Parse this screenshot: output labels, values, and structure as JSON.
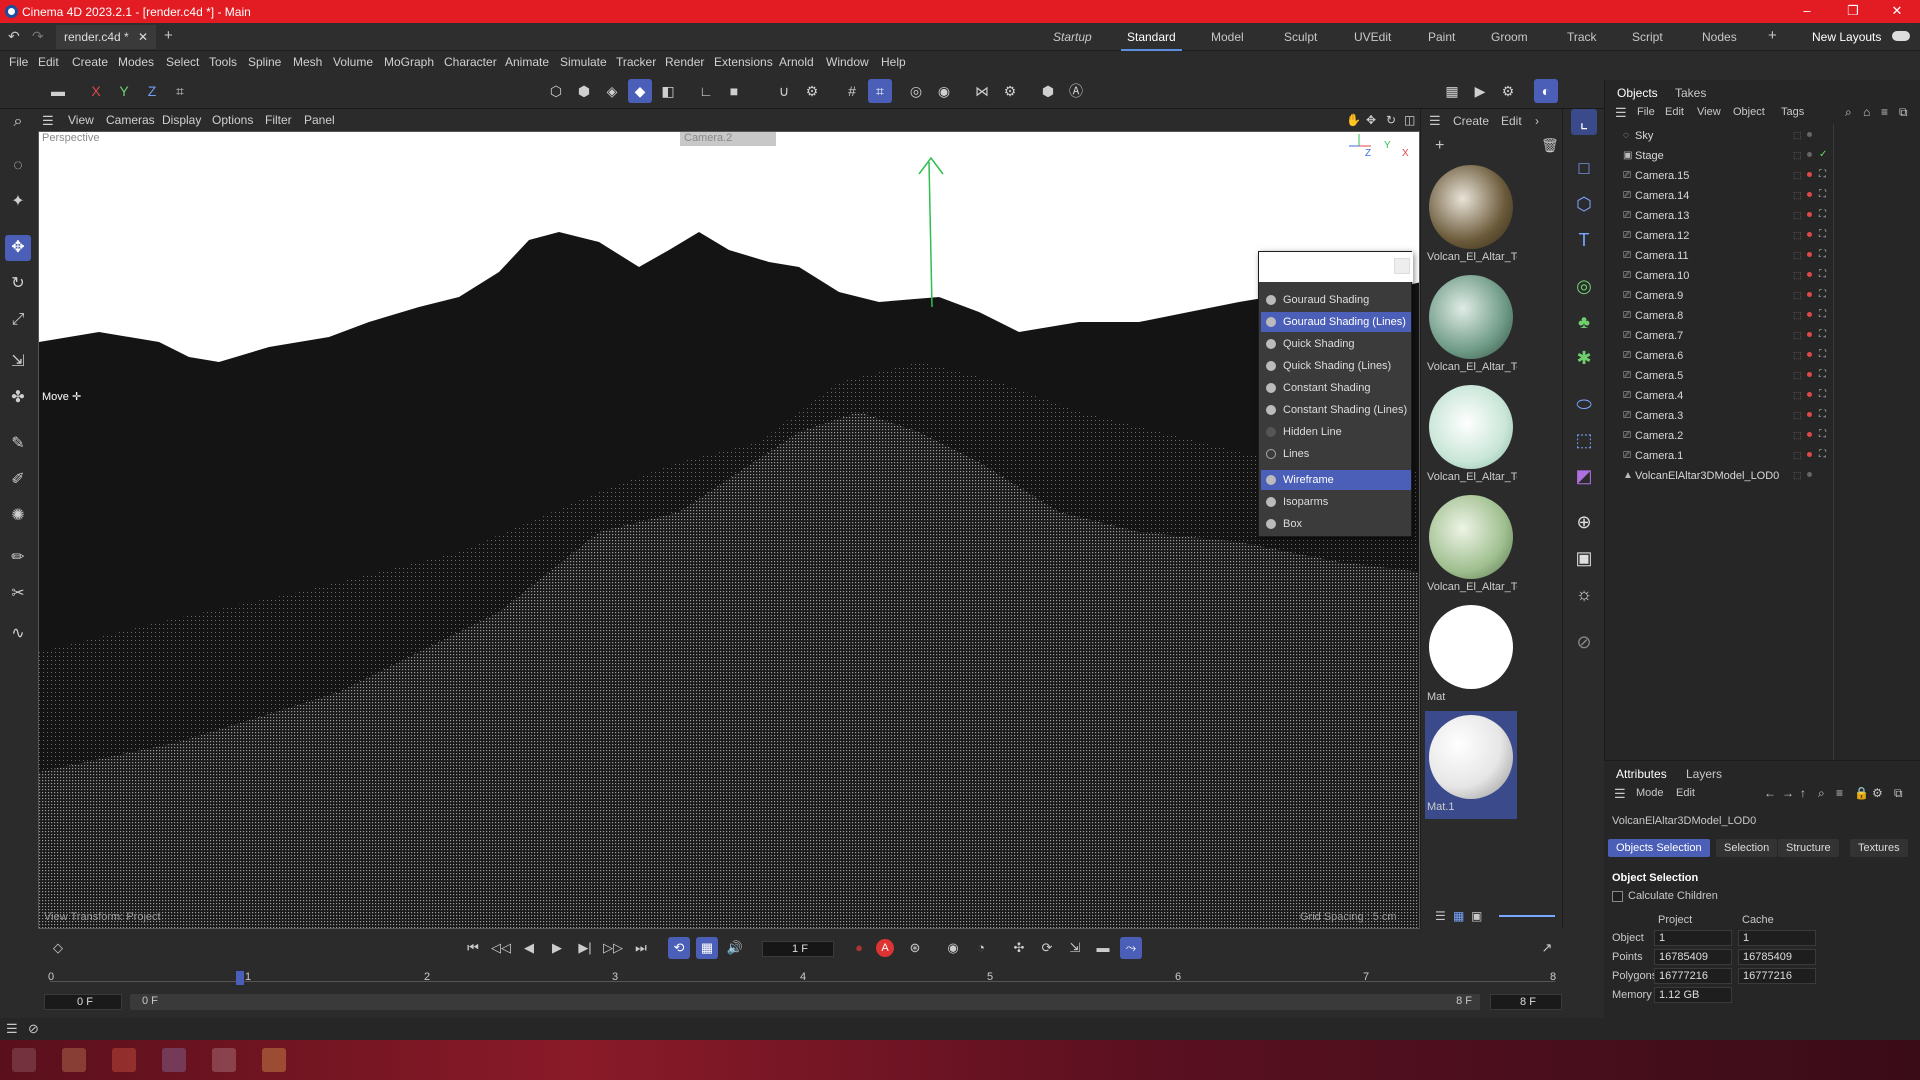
{
  "app": {
    "title": "Cinema 4D 2023.2.1 - [render.c4d *] - Main",
    "doc_tab": "render.c4d *",
    "window_controls": [
      "–",
      "❐",
      "✕"
    ]
  },
  "layouts": {
    "items": [
      "Startup",
      "Standard",
      "Model",
      "Sculpt",
      "UVEdit",
      "Paint",
      "Groom",
      "Track",
      "Script",
      "Nodes"
    ],
    "active": "Standard",
    "new_layouts": "New Layouts"
  },
  "menubar": [
    "File",
    "Edit",
    "Create",
    "Modes",
    "Select",
    "Tools",
    "Spline",
    "Mesh",
    "Volume",
    "MoGraph",
    "Character",
    "Animate",
    "Simulate",
    "Tracker",
    "Render",
    "Extensions",
    "Arnold",
    "Window",
    "Help"
  ],
  "toolbar": {
    "axes": [
      "X",
      "Y",
      "Z"
    ]
  },
  "viewport": {
    "menu": [
      "View",
      "Cameras",
      "Display",
      "Options",
      "Filter",
      "Panel"
    ],
    "label": "Perspective",
    "camera": "Camera.2",
    "move_label": "Move",
    "bottom_left": "View Transform: Project",
    "bottom_right": "Grid Spacing : 5 cm",
    "axis_labels": [
      "Z",
      "Y",
      "X"
    ]
  },
  "shading_menu": {
    "items": [
      {
        "label": "Gouraud Shading",
        "active": false
      },
      {
        "label": "Gouraud Shading (Lines)",
        "active": true
      },
      {
        "label": "Quick Shading",
        "active": false
      },
      {
        "label": "Quick Shading (Lines)",
        "active": false
      },
      {
        "label": "Constant Shading",
        "active": false
      },
      {
        "label": "Constant Shading (Lines)",
        "active": false
      },
      {
        "label": "Hidden Line",
        "active": false
      },
      {
        "label": "Lines",
        "active": false
      },
      {
        "label": "Wireframe",
        "active": true
      },
      {
        "label": "Isoparms",
        "active": false
      },
      {
        "label": "Box",
        "active": false
      }
    ]
  },
  "materials": {
    "menu": [
      "Create",
      "Edit"
    ],
    "items": [
      {
        "name": "Volcan_El_Altar_Te",
        "color": "#6b5a3a"
      },
      {
        "name": "Volcan_El_Altar_Te",
        "color": "#6e9a86"
      },
      {
        "name": "Volcan_El_Altar_Te",
        "color": "#c9e6d8"
      },
      {
        "name": "Volcan_El_Altar_Te",
        "color": "#9fbf8f"
      },
      {
        "name": "Mat",
        "color": "#ffffff"
      },
      {
        "name": "Mat.1",
        "color": "#e6e6e6"
      }
    ]
  },
  "objects": {
    "tabs": [
      "Objects",
      "Takes"
    ],
    "menu": [
      "File",
      "Edit",
      "View",
      "Object",
      "Tags"
    ],
    "items": [
      "Sky",
      "Stage",
      "Camera.15",
      "Camera.14",
      "Camera.13",
      "Camera.12",
      "Camera.11",
      "Camera.10",
      "Camera.9",
      "Camera.8",
      "Camera.7",
      "Camera.6",
      "Camera.5",
      "Camera.4",
      "Camera.3",
      "Camera.2",
      "Camera.1",
      "VolcanElAltar3DModel_LOD0"
    ]
  },
  "attributes": {
    "tabs": [
      "Attributes",
      "Layers"
    ],
    "menu": [
      "Mode",
      "Edit"
    ],
    "object_name": "VolcanElAltar3DModel_LOD0",
    "buttons": [
      "Objects Selection",
      "Selection",
      "Structure",
      "Textures"
    ],
    "section": "Object Selection",
    "calculate_children": "Calculate Children",
    "col_project": "Project",
    "col_cache": "Cache",
    "rows": [
      {
        "label": "Object",
        "project": "1",
        "cache": "1"
      },
      {
        "label": "Points",
        "project": "16785409",
        "cache": "16785409"
      },
      {
        "label": "Polygons",
        "project": "16777216",
        "cache": "16777216"
      },
      {
        "label": "Memory",
        "project": "1.12 GB",
        "cache": ""
      }
    ]
  },
  "timeline": {
    "frame": "1 F",
    "ticks": [
      "0",
      "1",
      "2",
      "3",
      "4",
      "5",
      "6",
      "7",
      "8"
    ],
    "start": "0 F",
    "start2": "0 F",
    "end": "8 F",
    "end2": "8 F"
  },
  "colors": {
    "accent": "#4b5fb8",
    "titlebar": "#e31b23"
  }
}
